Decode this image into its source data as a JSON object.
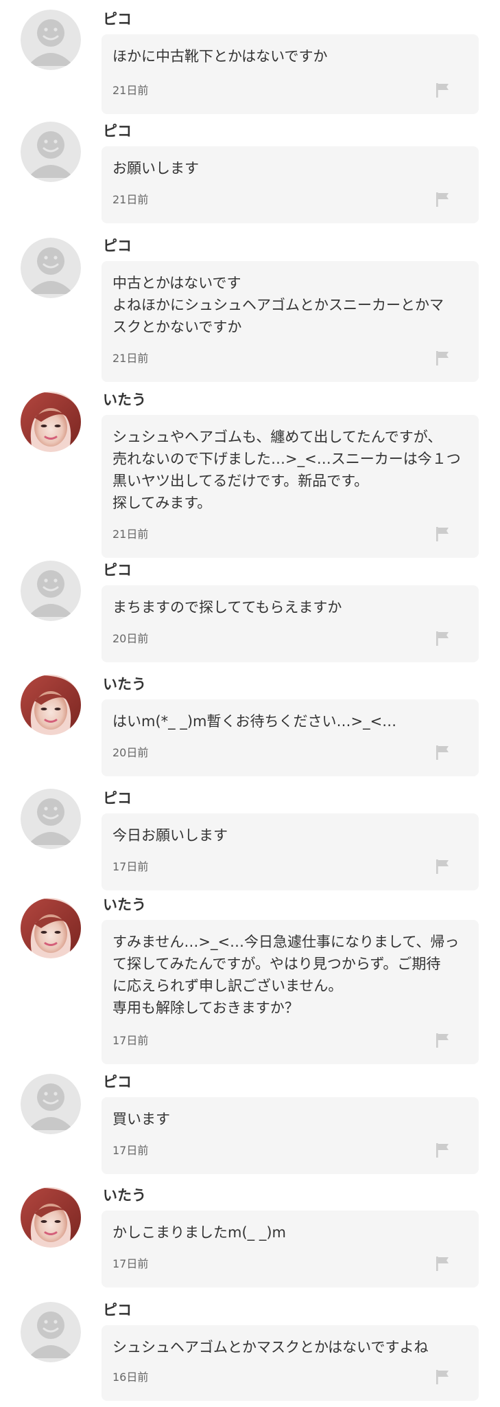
{
  "users": {
    "pico": {
      "name": "ピコ",
      "avatar_icon": "default-avatar-icon"
    },
    "itau": {
      "name": "いたう",
      "avatar_icon": "user-photo-avatar"
    }
  },
  "colors": {
    "bubble_bg": "#f5f5f5",
    "text": "#333333",
    "timestamp": "#666666",
    "flag": "#cccccc",
    "avatar_default_bg": "#e6e6e6",
    "avatar_default_fg": "#c8c8c8"
  },
  "messages": [
    {
      "sender": "ピコ",
      "text": "ほかに中古靴下とかはないですか",
      "time": "21日前"
    },
    {
      "sender": "ピコ",
      "text": "お願いします",
      "time": "21日前"
    },
    {
      "sender": "ピコ",
      "text": "中古とかはないです\nよねほかにシュシュヘアゴムとかスニーカーとかマ\nスクとかないですか",
      "time": "21日前"
    },
    {
      "sender": "いたう",
      "text": "シュシュやヘアゴムも、纏めて出してたんですが、\n売れないので下げました…>_<…スニーカーは今１つ\n黒いヤツ出してるだけです。新品です。\n探してみます。",
      "time": "21日前"
    },
    {
      "sender": "ピコ",
      "text": "まちますので探しててもらえますか",
      "time": "20日前"
    },
    {
      "sender": "いたう",
      "text": "はいm(*_ _)m暫くお待ちください…>_<…",
      "time": "20日前"
    },
    {
      "sender": "ピコ",
      "text": "今日お願いします",
      "time": "17日前"
    },
    {
      "sender": "いたう",
      "text": "すみません…>_<…今日急遽仕事になりまして、帰っ\nて探してみたんですが。やはり見つからず。ご期待\nに応えられず申し訳ございません。\n専用も解除しておきますか？",
      "time": "17日前"
    },
    {
      "sender": "ピコ",
      "text": "買います",
      "time": "17日前"
    },
    {
      "sender": "いたう",
      "text": "かしこまりましたm(_ _)m",
      "time": "17日前"
    },
    {
      "sender": "ピコ",
      "text": "シュシュヘアゴムとかマスクとかはないですよね",
      "time": "16日前"
    }
  ]
}
